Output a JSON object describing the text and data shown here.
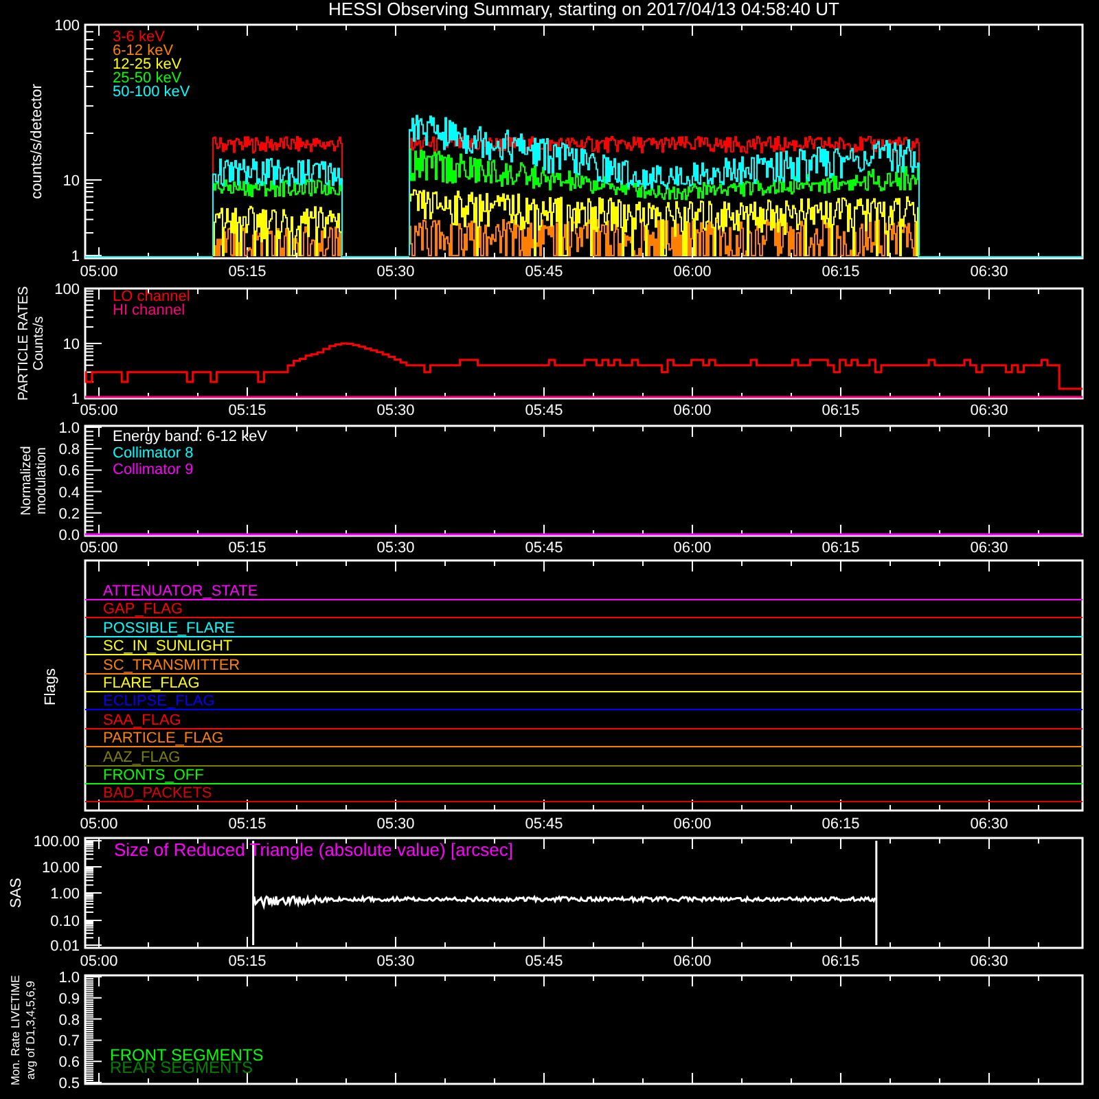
{
  "title": "HESSI Observing Summary, starting on 2017/04/13 04:58:40 UT",
  "counts_panel": {
    "ylabel": "counts/s/detector",
    "yticks": [
      "100",
      "10",
      "1"
    ],
    "legend": [
      {
        "label": "3-6 keV",
        "color": "#ff0000"
      },
      {
        "label": "6-12 keV",
        "color": "#ff8000"
      },
      {
        "label": "12-25 keV",
        "color": "#ffff00"
      },
      {
        "label": "25-50 keV",
        "color": "#00ff00"
      },
      {
        "label": "50-100 keV",
        "color": "#00ffff"
      }
    ],
    "xticks": [
      "05:00",
      "05:15",
      "05:30",
      "05:45",
      "06:00",
      "06:15",
      "06:30"
    ]
  },
  "particle_panel": {
    "ylabel": [
      "PARTICLE RATES",
      "Counts/s"
    ],
    "yticks": [
      "100",
      "10",
      "1"
    ],
    "legend": [
      {
        "label": "LO channel",
        "color": "#ff0000"
      },
      {
        "label": "HI channel",
        "color": "#ff0080"
      }
    ],
    "xticks": [
      "05:00",
      "05:15",
      "05:30",
      "05:45",
      "06:00",
      "06:15",
      "06:30"
    ]
  },
  "modulation_panel": {
    "ylabel": [
      "Normalized",
      "modulation"
    ],
    "yticks": [
      "1.0",
      "0.8",
      "0.6",
      "0.4",
      "0.2",
      "0.0"
    ],
    "legend": [
      {
        "label": "Energy band: 6-12 keV",
        "color": "#ffffff"
      },
      {
        "label": "Collimator 8",
        "color": "#00ffff"
      },
      {
        "label": "Collimator 9",
        "color": "#ff00ff"
      }
    ],
    "xticks": [
      "05:00",
      "05:15",
      "05:30",
      "05:45",
      "06:00",
      "06:15",
      "06:30"
    ]
  },
  "flags_panel": {
    "ylabel": "Flags",
    "flags": [
      {
        "name": "ATTENUATOR_STATE",
        "color": "#ff00ff"
      },
      {
        "name": "GAP_FLAG",
        "color": "#ff0000"
      },
      {
        "name": "POSSIBLE_FLARE",
        "color": "#00ffff"
      },
      {
        "name": "SC_IN_SUNLIGHT",
        "color": "#ffff00"
      },
      {
        "name": "SC_TRANSMITTER",
        "color": "#ff8000"
      },
      {
        "name": "FLARE_FLAG",
        "color": "#ffff00"
      },
      {
        "name": "ECLIPSE_FLAG",
        "color": "#0000ff"
      },
      {
        "name": "SAA_FLAG",
        "color": "#ff0000"
      },
      {
        "name": "PARTICLE_FLAG",
        "color": "#ff8000"
      },
      {
        "name": "AAZ_FLAG",
        "color": "#808000"
      },
      {
        "name": "FRONTS_OFF",
        "color": "#00ff00"
      },
      {
        "name": "BAD_PACKETS",
        "color": "#e00000"
      }
    ],
    "xticks": [
      "05:00",
      "05:15",
      "05:30",
      "05:45",
      "06:00",
      "06:15",
      "06:30"
    ]
  },
  "sas_panel": {
    "ylabel": "SAS",
    "yticks": [
      "100.00",
      "10.00",
      "1.00",
      "0.10",
      "0.01"
    ],
    "note": "Size of Reduced Triangle (absolute value) [arcsec]",
    "xticks": [
      "05:00",
      "05:15",
      "05:30",
      "05:45",
      "06:00",
      "06:15",
      "06:30"
    ]
  },
  "livetime_panel": {
    "ylabel": [
      "Mon. Rate LIVETIME",
      "avg of D1,3,4,5,6,9"
    ],
    "yticks": [
      "1.0",
      "0.9",
      "0.8",
      "0.7",
      "0.6",
      "0.5"
    ],
    "legend": [
      {
        "label": "FRONT SEGMENTS",
        "color": "#00ff00"
      },
      {
        "label": "REAR SEGMENTS",
        "color": "#008000"
      }
    ]
  }
}
